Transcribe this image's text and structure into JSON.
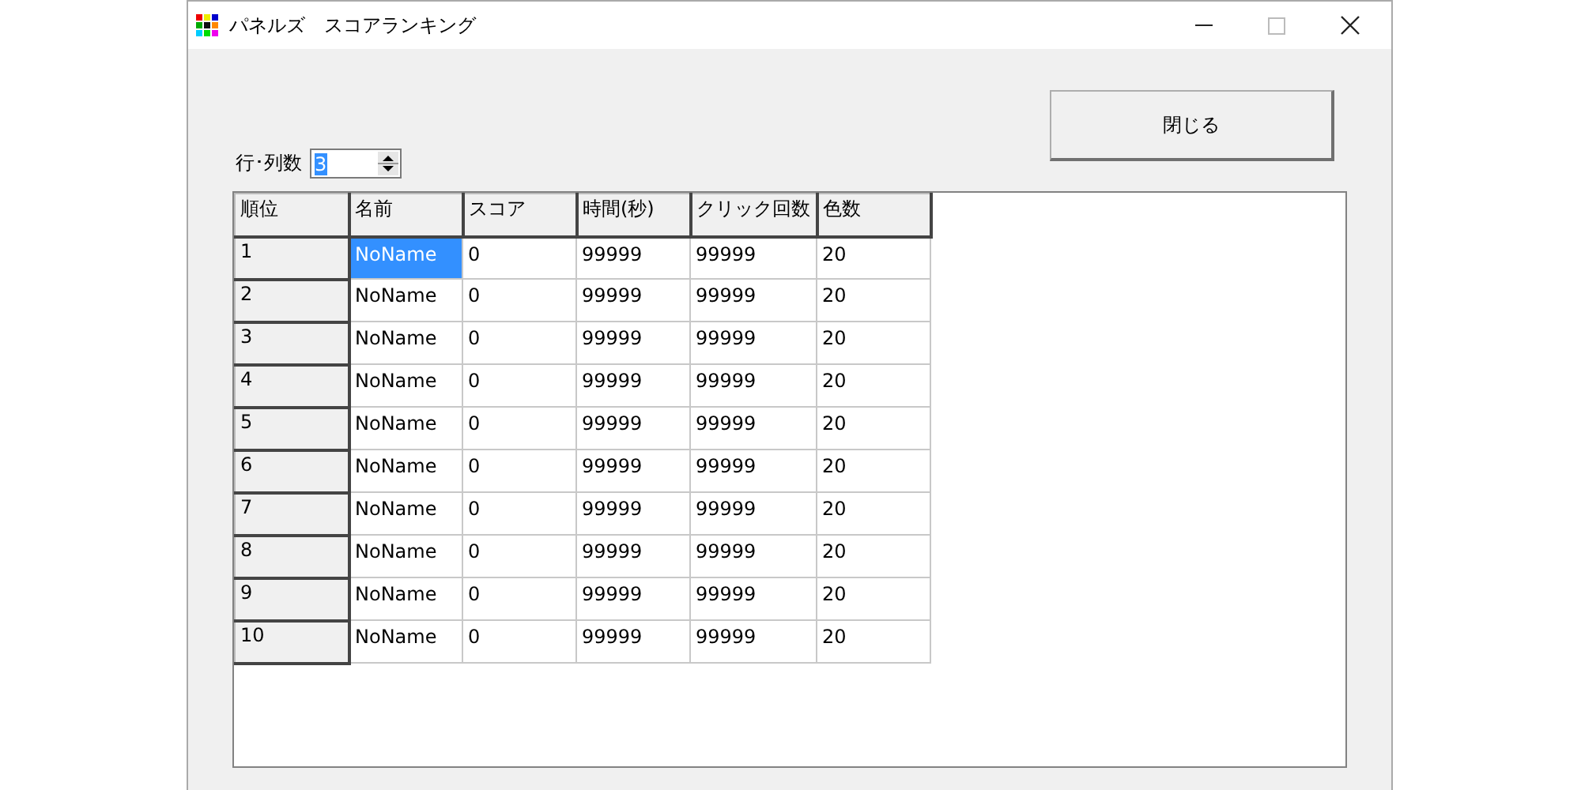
{
  "window": {
    "title": "パネルズ　スコアランキング"
  },
  "close_button": "閉じる",
  "size_field": {
    "label": "行･列数",
    "value": "3",
    "selected": true
  },
  "table": {
    "columns": [
      "順位",
      "名前",
      "スコア",
      "時間(秒)",
      "クリック回数",
      "色数"
    ],
    "rows": [
      {
        "cells": [
          {
            "text": "1",
            "selected": false
          },
          {
            "text": "NoName",
            "selected": true
          },
          {
            "text": "0",
            "selected": false
          },
          {
            "text": "99999",
            "selected": false
          },
          {
            "text": "99999",
            "selected": false
          },
          {
            "text": "20",
            "selected": false
          }
        ]
      },
      {
        "cells": [
          {
            "text": "2",
            "selected": false
          },
          {
            "text": "NoName",
            "selected": false
          },
          {
            "text": "0",
            "selected": false
          },
          {
            "text": "99999",
            "selected": false
          },
          {
            "text": "99999",
            "selected": false
          },
          {
            "text": "20",
            "selected": false
          }
        ]
      },
      {
        "cells": [
          {
            "text": "3",
            "selected": false
          },
          {
            "text": "NoName",
            "selected": false
          },
          {
            "text": "0",
            "selected": false
          },
          {
            "text": "99999",
            "selected": false
          },
          {
            "text": "99999",
            "selected": false
          },
          {
            "text": "20",
            "selected": false
          }
        ]
      },
      {
        "cells": [
          {
            "text": "4",
            "selected": false
          },
          {
            "text": "NoName",
            "selected": false
          },
          {
            "text": "0",
            "selected": false
          },
          {
            "text": "99999",
            "selected": false
          },
          {
            "text": "99999",
            "selected": false
          },
          {
            "text": "20",
            "selected": false
          }
        ]
      },
      {
        "cells": [
          {
            "text": "5",
            "selected": false
          },
          {
            "text": "NoName",
            "selected": false
          },
          {
            "text": "0",
            "selected": false
          },
          {
            "text": "99999",
            "selected": false
          },
          {
            "text": "99999",
            "selected": false
          },
          {
            "text": "20",
            "selected": false
          }
        ]
      },
      {
        "cells": [
          {
            "text": "6",
            "selected": false
          },
          {
            "text": "NoName",
            "selected": false
          },
          {
            "text": "0",
            "selected": false
          },
          {
            "text": "99999",
            "selected": false
          },
          {
            "text": "99999",
            "selected": false
          },
          {
            "text": "20",
            "selected": false
          }
        ]
      },
      {
        "cells": [
          {
            "text": "7",
            "selected": false
          },
          {
            "text": "NoName",
            "selected": false
          },
          {
            "text": "0",
            "selected": false
          },
          {
            "text": "99999",
            "selected": false
          },
          {
            "text": "99999",
            "selected": false
          },
          {
            "text": "20",
            "selected": false
          }
        ]
      },
      {
        "cells": [
          {
            "text": "8",
            "selected": false
          },
          {
            "text": "NoName",
            "selected": false
          },
          {
            "text": "0",
            "selected": false
          },
          {
            "text": "99999",
            "selected": false
          },
          {
            "text": "99999",
            "selected": false
          },
          {
            "text": "20",
            "selected": false
          }
        ]
      },
      {
        "cells": [
          {
            "text": "9",
            "selected": false
          },
          {
            "text": "NoName",
            "selected": false
          },
          {
            "text": "0",
            "selected": false
          },
          {
            "text": "99999",
            "selected": false
          },
          {
            "text": "99999",
            "selected": false
          },
          {
            "text": "20",
            "selected": false
          }
        ]
      },
      {
        "cells": [
          {
            "text": "10",
            "selected": false
          },
          {
            "text": "NoName",
            "selected": false
          },
          {
            "text": "0",
            "selected": false
          },
          {
            "text": "99999",
            "selected": false
          },
          {
            "text": "99999",
            "selected": false
          },
          {
            "text": "20",
            "selected": false
          }
        ]
      }
    ]
  }
}
